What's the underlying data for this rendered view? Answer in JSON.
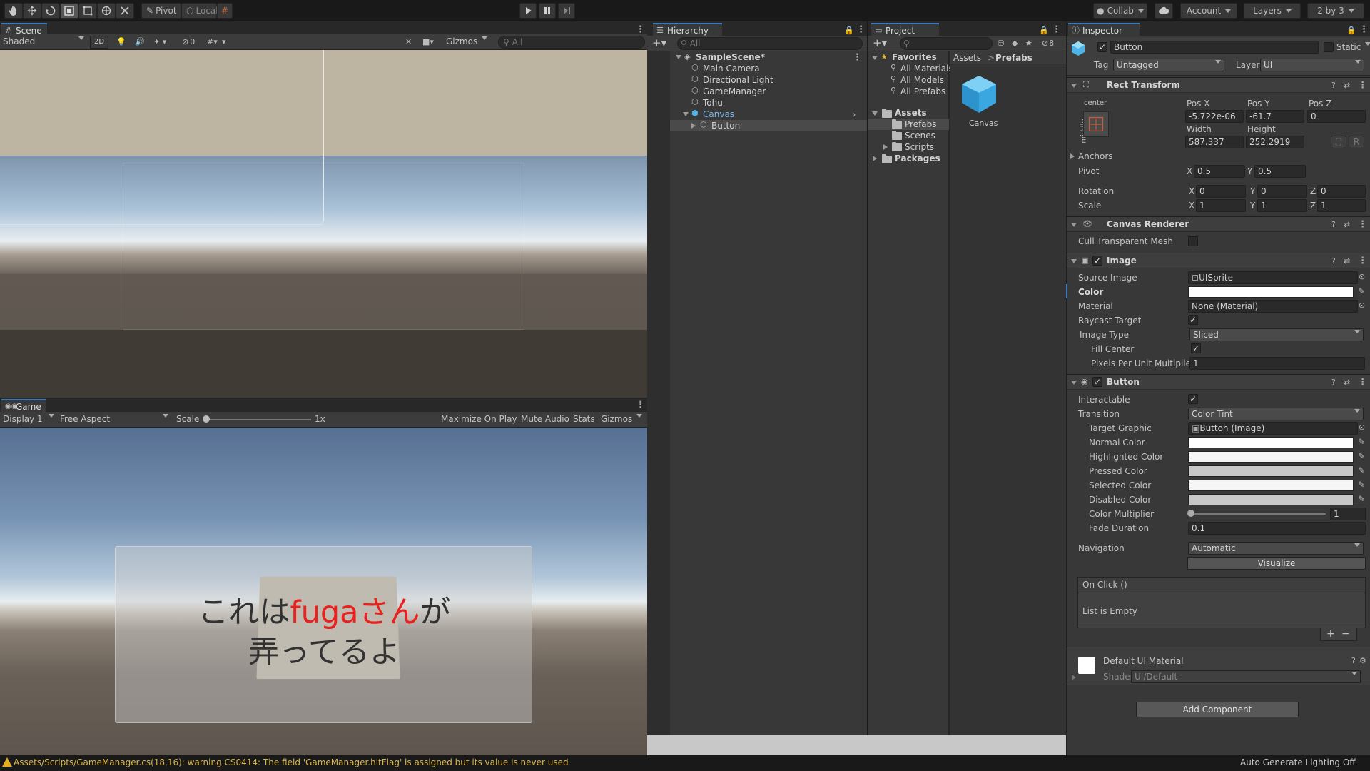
{
  "toolbar": {
    "pivot_label": "Pivot",
    "local_label": "Local",
    "collab_label": "Collab",
    "account_label": "Account",
    "layers_label": "Layers",
    "layout_label": "2 by 3"
  },
  "scene": {
    "tab_label": "Scene",
    "shading": "Shaded",
    "mode_2d": "2D",
    "hidden_count": "0",
    "gizmos_label": "Gizmos",
    "search_placeholder": "All"
  },
  "game": {
    "tab_label": "Game",
    "display": "Display 1",
    "aspect": "Free Aspect",
    "scale_label": "Scale",
    "scale_value": "1x",
    "maximize_label": "Maximize On Play",
    "mute_label": "Mute Audio",
    "stats_label": "Stats",
    "gizmos_label": "Gizmos",
    "text_line1_part1": "これは",
    "text_line1_part2": "fugaさん",
    "text_line1_part3": "が",
    "text_line2": "弄ってるよ",
    "highlight_color": "#e8231f"
  },
  "hierarchy": {
    "tab_label": "Hierarchy",
    "search_placeholder": "All",
    "scene_name": "SampleScene*",
    "items": [
      {
        "label": "Main Camera"
      },
      {
        "label": "Directional Light"
      },
      {
        "label": "GameManager"
      },
      {
        "label": "Tohu"
      },
      {
        "label": "Canvas"
      },
      {
        "label": "Button"
      }
    ]
  },
  "project": {
    "tab_label": "Project",
    "hidden_count": "8",
    "favorites_label": "Favorites",
    "favorites": [
      {
        "label": "All Materials"
      },
      {
        "label": "All Models"
      },
      {
        "label": "All Prefabs"
      }
    ],
    "assets_label": "Assets",
    "folders": [
      {
        "label": "Prefabs"
      },
      {
        "label": "Scenes"
      },
      {
        "label": "Scripts"
      }
    ],
    "packages_label": "Packages",
    "breadcrumb_root": "Assets",
    "breadcrumb_sep": ">",
    "breadcrumb_current": "Prefabs",
    "asset_name": "Canvas"
  },
  "inspector": {
    "tab_label": "Inspector",
    "object_name": "Button",
    "static_label": "Static",
    "tag_label": "Tag",
    "tag_value": "Untagged",
    "layer_label": "Layer",
    "layer_value": "UI",
    "rect_transform": {
      "title": "Rect Transform",
      "anchor_h": "center",
      "anchor_v": "middle",
      "posx_label": "Pos X",
      "posx": "-5.722e-06",
      "posy_label": "Pos Y",
      "posy": "-61.7",
      "posz_label": "Pos Z",
      "posz": "0",
      "width_label": "Width",
      "width": "587.337",
      "height_label": "Height",
      "height": "252.2919",
      "r_label": "R",
      "anchors_label": "Anchors",
      "pivot_label": "Pivot",
      "pivot_x": "0.5",
      "pivot_y": "0.5",
      "rotation_label": "Rotation",
      "rot_x": "0",
      "rot_y": "0",
      "rot_z": "0",
      "scale_label": "Scale",
      "scale_x": "1",
      "scale_y": "1",
      "scale_z": "1",
      "x": "X",
      "y": "Y",
      "z": "Z"
    },
    "canvas_renderer": {
      "title": "Canvas Renderer",
      "cull_label": "Cull Transparent Mesh"
    },
    "image": {
      "title": "Image",
      "source_label": "Source Image",
      "source_value": "UISprite",
      "color_label": "Color",
      "material_label": "Material",
      "material_value": "None (Material)",
      "raycast_label": "Raycast Target",
      "type_label": "Image Type",
      "type_value": "Sliced",
      "fill_label": "Fill Center",
      "ppu_label": "Pixels Per Unit Multiplier",
      "ppu_value": "1"
    },
    "button": {
      "title": "Button",
      "interactable_label": "Interactable",
      "transition_label": "Transition",
      "transition_value": "Color Tint",
      "target_label": "Target Graphic",
      "target_value": "Button (Image)",
      "normal_label": "Normal Color",
      "highlighted_label": "Highlighted Color",
      "pressed_label": "Pressed Color",
      "selected_label": "Selected Color",
      "disabled_label": "Disabled Color",
      "multiplier_label": "Color Multiplier",
      "multiplier_value": "1",
      "fade_label": "Fade Duration",
      "fade_value": "0.1",
      "navigation_label": "Navigation",
      "navigation_value": "Automatic",
      "visualize_label": "Visualize",
      "onclick_label": "On Click ()",
      "empty_label": "List is Empty",
      "plus": "+",
      "minus": "−"
    },
    "material": {
      "title": "Default UI Material",
      "shader_label": "Shader",
      "shader_value": "UI/Default"
    },
    "add_component_label": "Add Component"
  },
  "status": {
    "warning": "Assets/Scripts/GameManager.cs(18,16): warning CS0414: The field 'GameManager.hitFlag' is assigned but its value is never used",
    "right": "Auto Generate Lighting Off"
  }
}
